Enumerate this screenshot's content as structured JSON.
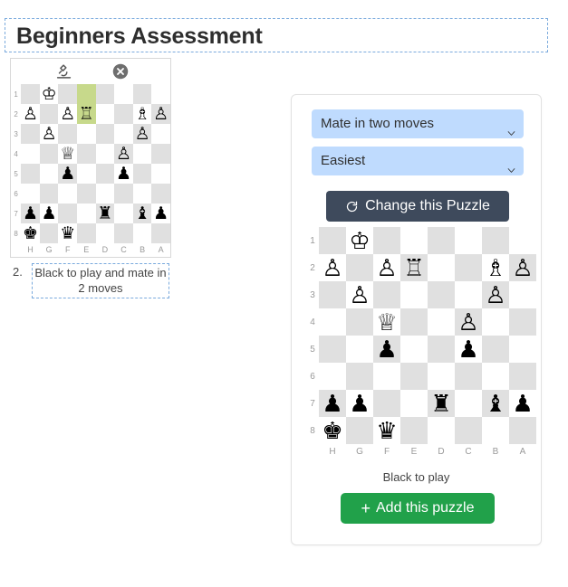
{
  "page": {
    "title": "Beginners Assessment"
  },
  "left_puzzle": {
    "toolbar": {
      "analyze_icon": "microscope-icon",
      "close_icon": "close-circle-icon"
    },
    "caption_number": "2.",
    "caption": "Black to play and mate in 2 moves",
    "board": {
      "files": [
        "H",
        "G",
        "F",
        "E",
        "D",
        "C",
        "B",
        "A"
      ],
      "ranks": [
        "1",
        "2",
        "3",
        "4",
        "5",
        "6",
        "7",
        "8"
      ],
      "highlighted_squares": [
        "E1",
        "E2"
      ],
      "highlight_color": "#c7d98b",
      "light_color": "#ffffff",
      "dark_color": "#e0e0e0",
      "rows": [
        [
          null,
          "wK",
          null,
          null,
          null,
          null,
          null,
          null
        ],
        [
          "wP",
          null,
          "wP",
          "wR",
          null,
          null,
          "wB",
          "wP"
        ],
        [
          null,
          "wP",
          null,
          null,
          null,
          null,
          "wP",
          null
        ],
        [
          null,
          null,
          "wQ",
          null,
          null,
          "wP",
          null,
          null
        ],
        [
          null,
          null,
          "bP",
          null,
          null,
          "bP",
          null,
          null
        ],
        [
          null,
          null,
          null,
          null,
          null,
          null,
          null,
          null
        ],
        [
          "bP",
          "bP",
          null,
          null,
          "bR",
          null,
          "bB",
          "bP"
        ],
        [
          "bK",
          null,
          "bQ",
          null,
          null,
          null,
          null,
          null
        ]
      ]
    }
  },
  "right_panel": {
    "select_type": {
      "value": "Mate in two moves",
      "options": [
        "Mate in two moves"
      ]
    },
    "select_difficulty": {
      "value": "Easiest",
      "options": [
        "Easiest"
      ]
    },
    "change_button": {
      "label": "Change this Puzzle",
      "icon": "refresh-icon"
    },
    "turn_text": "Black to play",
    "add_button": {
      "plus": "+",
      "label": "Add this puzzle",
      "color": "#21a14a"
    },
    "board": {
      "files": [
        "H",
        "G",
        "F",
        "E",
        "D",
        "C",
        "B",
        "A"
      ],
      "ranks": [
        "1",
        "2",
        "3",
        "4",
        "5",
        "6",
        "7",
        "8"
      ],
      "highlighted_squares": [],
      "light_color": "#ffffff",
      "dark_color": "#e0e0e0",
      "rows": [
        [
          null,
          "wK",
          null,
          null,
          null,
          null,
          null,
          null
        ],
        [
          "wP",
          null,
          "wP",
          "wR",
          null,
          null,
          "wB",
          "wP"
        ],
        [
          null,
          "wP",
          null,
          null,
          null,
          null,
          "wP",
          null
        ],
        [
          null,
          null,
          "wQ",
          null,
          null,
          "wP",
          null,
          null
        ],
        [
          null,
          null,
          "bP",
          null,
          null,
          "bP",
          null,
          null
        ],
        [
          null,
          null,
          null,
          null,
          null,
          null,
          null,
          null
        ],
        [
          "bP",
          "bP",
          null,
          null,
          "bR",
          null,
          "bB",
          "bP"
        ],
        [
          "bK",
          null,
          "bQ",
          null,
          null,
          null,
          null,
          null
        ]
      ]
    }
  }
}
